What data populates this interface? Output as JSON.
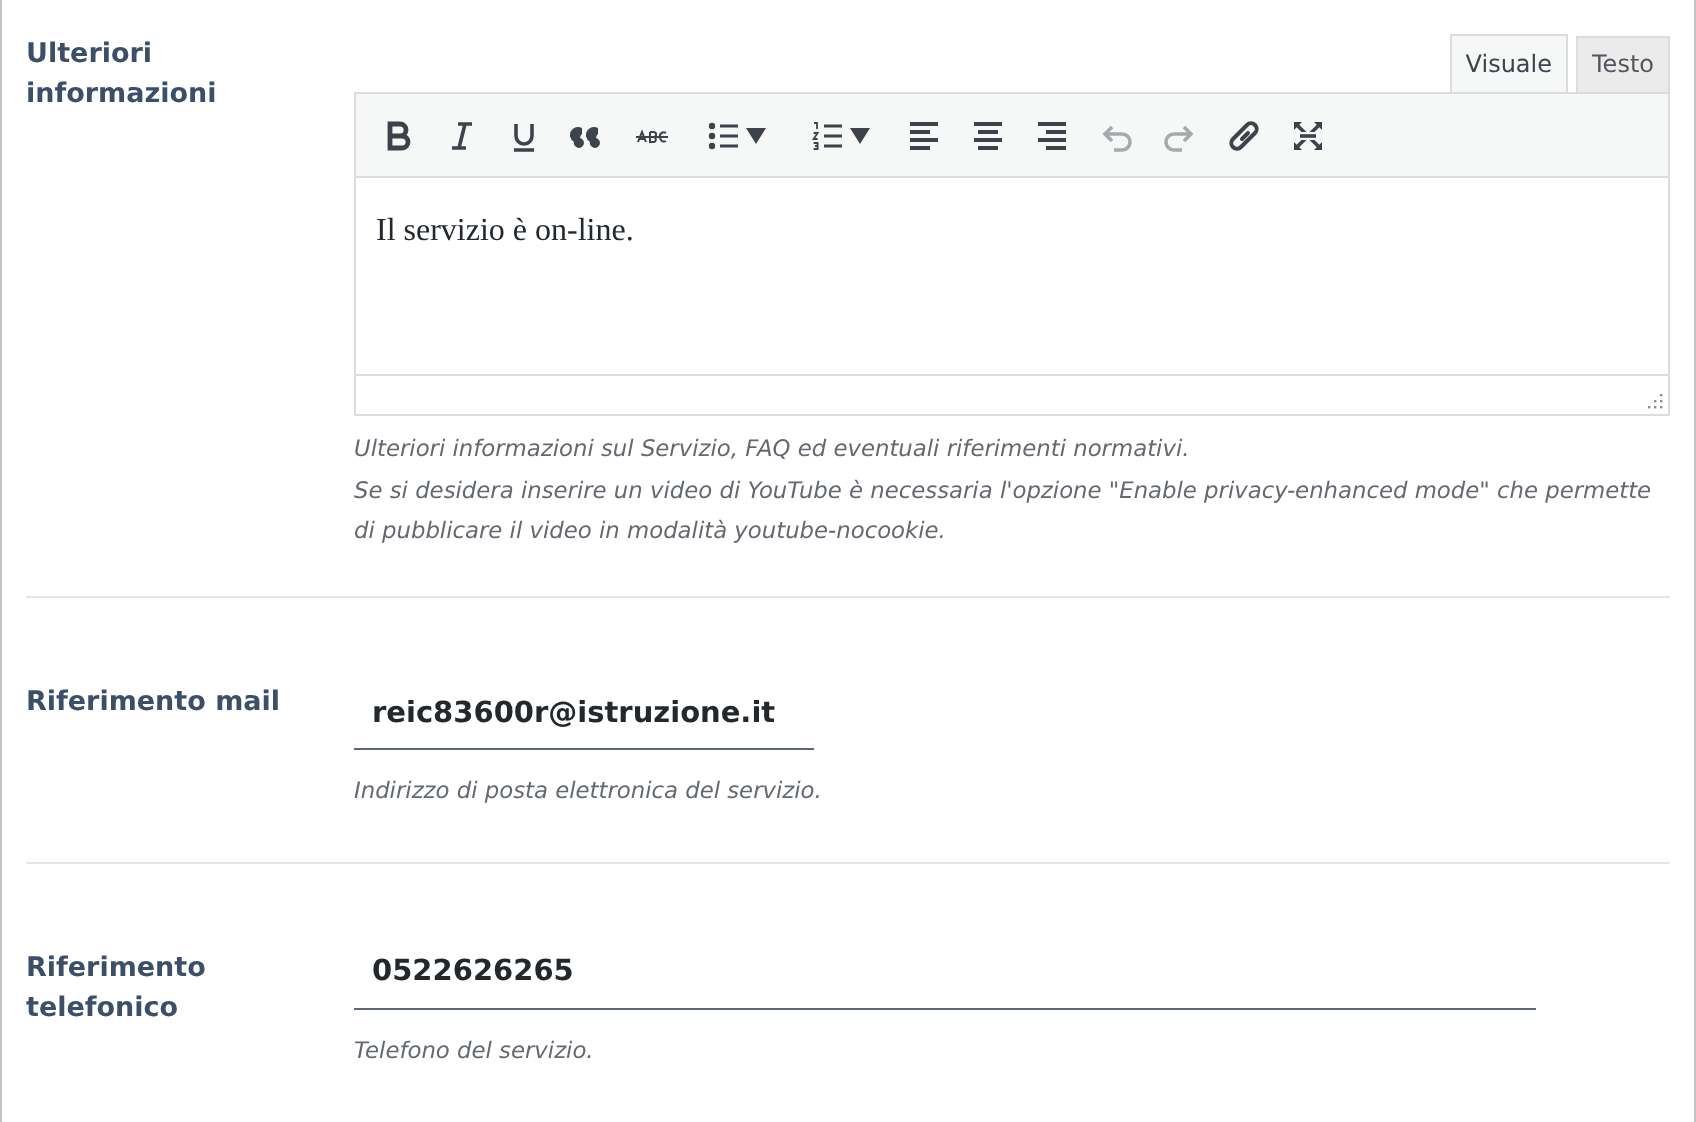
{
  "sections": [
    {
      "kind": "editor",
      "label": "Ulteriori informazioni",
      "tabs": [
        {
          "label": "Visuale",
          "selected": true
        },
        {
          "label": "Testo",
          "selected": false
        }
      ],
      "toolbar": [
        {
          "kind": "bold",
          "disabled": false,
          "has_menu": false
        },
        {
          "kind": "italic",
          "disabled": false,
          "has_menu": false
        },
        {
          "kind": "underline",
          "disabled": false,
          "has_menu": false
        },
        {
          "kind": "quote",
          "disabled": false,
          "has_menu": false
        },
        {
          "kind": "strike",
          "disabled": false,
          "has_menu": false
        },
        {
          "kind": "bullets",
          "disabled": false,
          "has_menu": true
        },
        {
          "kind": "numbers",
          "disabled": false,
          "has_menu": true
        },
        {
          "kind": "align-left",
          "disabled": false,
          "has_menu": false
        },
        {
          "kind": "align-center",
          "disabled": false,
          "has_menu": false
        },
        {
          "kind": "align-right",
          "disabled": false,
          "has_menu": false
        },
        {
          "kind": "undo",
          "disabled": true,
          "has_menu": false
        },
        {
          "kind": "redo",
          "disabled": true,
          "has_menu": false
        },
        {
          "kind": "link",
          "disabled": false,
          "has_menu": false
        },
        {
          "kind": "fullscreen",
          "disabled": false,
          "has_menu": false
        }
      ],
      "content": "Il servizio è on-line.",
      "help": [
        "Ulteriori informazioni sul Servizio, FAQ ed eventuali riferimenti normativi.",
        "Se si desidera inserire un video di YouTube è necessaria l'opzione \"Enable privacy-enhanced mode\" che permette di pubblicare il video in modalità youtube-nocookie."
      ]
    },
    {
      "kind": "field",
      "label": "Riferimento mail",
      "value": "reic83600r@istruzione.it",
      "help": [
        "Indirizzo di posta elettronica del servizio."
      ]
    },
    {
      "kind": "field",
      "label": "Riferimento telefonico",
      "value": "0522626265",
      "help": [
        "Telefono del servizio."
      ]
    }
  ]
}
